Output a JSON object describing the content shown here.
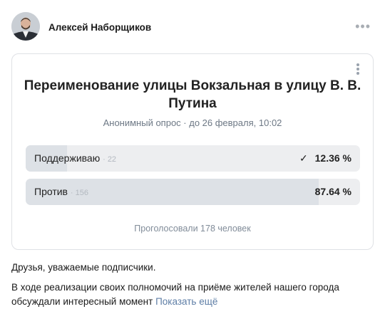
{
  "post": {
    "author": "Алексей Наборщиков",
    "more_glyph": "•••"
  },
  "poll": {
    "title": "Переименование улицы Вокзальная в улицу В. В. Путина",
    "meta": "Анонимный опрос · до 26 февраля, 10:02",
    "options": [
      {
        "label": "Поддерживаю",
        "count": "· 22",
        "check": "✓",
        "percent_text": "12.36 %",
        "share": 12.36
      },
      {
        "label": "Против",
        "count": "· 156",
        "check": "",
        "percent_text": "87.64 %",
        "share": 87.64
      }
    ],
    "voted": "Проголосовали 178 человек"
  },
  "text": {
    "paragraph1": "Друзья, уважаемые подписчики.",
    "paragraph2": "В ходе реализации своих полномочий на приёме жителей нашего города обсуждали интересный момент",
    "show_more": "Показать ещё"
  },
  "icons": {
    "avatar": "avatar-icon",
    "more_horizontal": "more-horizontal-icon",
    "more_vertical": "more-vertical-icon",
    "check": "check-icon"
  },
  "colors": {
    "option_bg": "#edeef0",
    "option_fill": "#dde1e6",
    "link": "#5e7ea6",
    "meta": "#6d7885"
  }
}
